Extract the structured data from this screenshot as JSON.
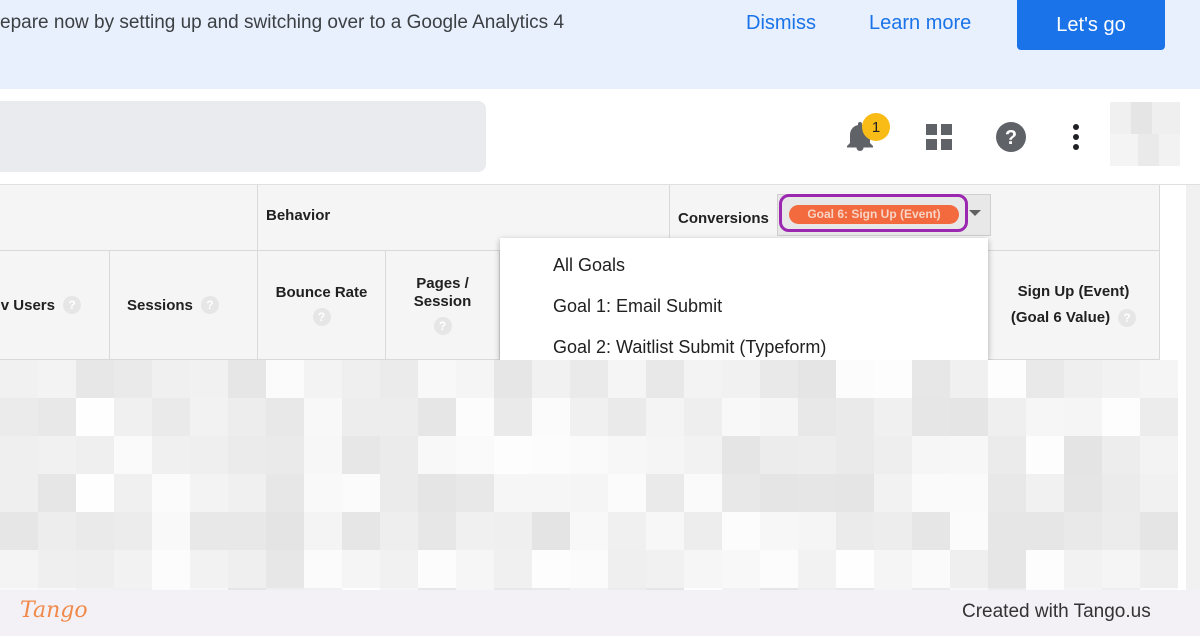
{
  "banner": {
    "text": "epare now by setting up and switching over to a Google Analytics 4",
    "dismiss": "Dismiss",
    "learn_more": "Learn more",
    "lets_go": "Let's go"
  },
  "header": {
    "notification_count": "1",
    "icons": [
      "bell-icon",
      "apps-grid-icon",
      "help-icon",
      "more-vert-icon"
    ]
  },
  "table": {
    "groups": {
      "behavior": "Behavior",
      "conversions": "Conversions"
    },
    "conversions_selected": "Goal 6: Sign Up (Event)",
    "columns": {
      "new_users": "v Users",
      "sessions": "Sessions",
      "bounce_rate": "Bounce Rate",
      "pages_session": "Pages / Session",
      "sign_up_event": "Sign Up (Event)",
      "goal_6_value": "(Goal 6 Value)"
    },
    "help_glyph": "?"
  },
  "dropdown": {
    "items": [
      "All Goals",
      "Goal 1: Email Submit",
      "Goal 2: Waitlist Submit (Typeform)"
    ]
  },
  "footer": {
    "logo": "Tango",
    "credit": "Created with Tango.us"
  },
  "colors": {
    "accent": "#1a73e8",
    "highlight": "#9c27b0",
    "pill": "#f26a3d",
    "badge": "#f9bc16"
  }
}
